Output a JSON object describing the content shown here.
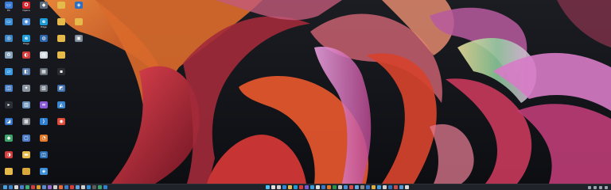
{
  "colors": {
    "background": "#0f1115",
    "taskbar": "#1f2228",
    "accent_orange": "#e0642a",
    "accent_red": "#c02a36",
    "accent_pink": "#e77bd8",
    "accent_yellow": "#e8d36a"
  },
  "desktop": {
    "icons": [
      {
        "label": "PC",
        "icon": "pc-icon",
        "color": "#3a7bd5",
        "glyph": "▭"
      },
      {
        "label": "Opera",
        "icon": "opera-icon",
        "color": "#d8262e",
        "glyph": "O"
      },
      {
        "label": "",
        "icon": "app-icon",
        "color": "#5e6b7a",
        "glyph": "◆"
      },
      {
        "label": "",
        "icon": "folder-icon",
        "color": "#e6b94b",
        "glyph": ""
      },
      {
        "label": "",
        "icon": "app-icon",
        "color": "#2f6fbf",
        "glyph": "◈"
      },
      {
        "label": "",
        "icon": "monitor-icon",
        "color": "#3a8fd6",
        "glyph": "▭"
      },
      {
        "label": "",
        "icon": "app-icon",
        "color": "#4b8bd1",
        "glyph": "◉"
      },
      {
        "label": "Edge",
        "icon": "edge-icon",
        "color": "#1f9bd8",
        "glyph": "e"
      },
      {
        "label": "",
        "icon": "folder-icon",
        "color": "#e6b94b",
        "glyph": ""
      },
      {
        "label": "",
        "icon": "folder-icon",
        "color": "#e6b94b",
        "glyph": ""
      },
      {
        "label": "",
        "icon": "network-icon",
        "color": "#3d86c6",
        "glyph": "◎"
      },
      {
        "label": "Edge",
        "icon": "edge-icon",
        "color": "#1f9bd8",
        "glyph": "e"
      },
      {
        "label": "",
        "icon": "app-icon",
        "color": "#2d64a8",
        "glyph": "◍"
      },
      {
        "label": "",
        "icon": "folder-icon",
        "color": "#e6b94b",
        "glyph": ""
      },
      {
        "label": "",
        "icon": "app-icon",
        "color": "#7f8b99",
        "glyph": "▣"
      },
      {
        "label": "",
        "icon": "recycle-bin-icon",
        "color": "#8aa4bd",
        "glyph": "♻"
      },
      {
        "label": "",
        "icon": "app-icon",
        "color": "#d43a3a",
        "glyph": "◐"
      },
      {
        "label": "",
        "icon": "app-icon",
        "color": "#cfd6de",
        "glyph": "▤"
      },
      {
        "label": "",
        "icon": "folder-icon",
        "color": "#e6b94b",
        "glyph": ""
      },
      {
        "label": "",
        "icon": "empty",
        "color": "transparent",
        "glyph": ""
      },
      {
        "label": "",
        "icon": "chat-icon",
        "color": "#3d9ae0",
        "glyph": "▱"
      },
      {
        "label": "",
        "icon": "app-icon",
        "color": "#5277a6",
        "glyph": "◧"
      },
      {
        "label": "",
        "icon": "app-icon",
        "color": "#666e78",
        "glyph": "▦"
      },
      {
        "label": "",
        "icon": "app-icon",
        "color": "#2a2d33",
        "glyph": "▪"
      },
      {
        "label": "",
        "icon": "empty",
        "color": "transparent",
        "glyph": ""
      },
      {
        "label": "",
        "icon": "app-icon",
        "color": "#4a7fc4",
        "glyph": "◫"
      },
      {
        "label": "",
        "icon": "settings-icon",
        "color": "#8b949e",
        "glyph": "✦"
      },
      {
        "label": "",
        "icon": "app-icon",
        "color": "#6d7580",
        "glyph": "▧"
      },
      {
        "label": "",
        "icon": "app-icon",
        "color": "#3f6ea8",
        "glyph": "◩"
      },
      {
        "label": "",
        "icon": "empty",
        "color": "transparent",
        "glyph": ""
      },
      {
        "label": "",
        "icon": "terminal-icon",
        "color": "#2b2f36",
        "glyph": "▸"
      },
      {
        "label": "",
        "icon": "app-icon",
        "color": "#6a8fb8",
        "glyph": "▥"
      },
      {
        "label": "",
        "icon": "visual-studio-icon",
        "color": "#8a5bd6",
        "glyph": "∞"
      },
      {
        "label": "",
        "icon": "app-icon",
        "color": "#3a86d0",
        "glyph": "◭"
      },
      {
        "label": "",
        "icon": "empty",
        "color": "transparent",
        "glyph": ""
      },
      {
        "label": "",
        "icon": "app-icon",
        "color": "#3376c9",
        "glyph": "◪"
      },
      {
        "label": "",
        "icon": "app-icon",
        "color": "#7a818a",
        "glyph": "▩"
      },
      {
        "label": "",
        "icon": "vscode-icon",
        "color": "#2f80d1",
        "glyph": "⟩"
      },
      {
        "label": "",
        "icon": "chrome-icon",
        "color": "#dd4b39",
        "glyph": "◉"
      },
      {
        "label": "",
        "icon": "empty",
        "color": "transparent",
        "glyph": ""
      },
      {
        "label": "",
        "icon": "app-icon",
        "color": "#3fa36b",
        "glyph": "◆"
      },
      {
        "label": "",
        "icon": "app-icon",
        "color": "#4d7cc2",
        "glyph": "▢"
      },
      {
        "label": "",
        "icon": "app-icon",
        "color": "#e07a2a",
        "glyph": "◔"
      },
      {
        "label": "",
        "icon": "empty",
        "color": "transparent",
        "glyph": ""
      },
      {
        "label": "",
        "icon": "empty",
        "color": "transparent",
        "glyph": ""
      },
      {
        "label": "",
        "icon": "app-icon",
        "color": "#d23c3c",
        "glyph": "◑"
      },
      {
        "label": "",
        "icon": "app-icon",
        "color": "#e6b94b",
        "glyph": "▬"
      },
      {
        "label": "",
        "icon": "app-icon",
        "color": "#2c6fb5",
        "glyph": "◫"
      },
      {
        "label": "",
        "icon": "empty",
        "color": "transparent",
        "glyph": ""
      },
      {
        "label": "",
        "icon": "empty",
        "color": "transparent",
        "glyph": ""
      },
      {
        "label": "",
        "icon": "folder-icon",
        "color": "#e6b94b",
        "glyph": ""
      },
      {
        "label": "",
        "icon": "folder-icon",
        "color": "#d9a83a",
        "glyph": ""
      },
      {
        "label": "",
        "icon": "app-icon",
        "color": "#3c8fd8",
        "glyph": "◈"
      },
      {
        "label": "",
        "icon": "empty",
        "color": "transparent",
        "glyph": ""
      },
      {
        "label": "",
        "icon": "empty",
        "color": "transparent",
        "glyph": ""
      }
    ]
  },
  "taskbar": {
    "left": [
      {
        "icon": "widgets-icon",
        "color": "#4aa3df"
      },
      {
        "icon": "app-icon",
        "color": "#3b82c8"
      },
      {
        "icon": "app-icon",
        "color": "#d9d9d9"
      },
      {
        "icon": "app-icon",
        "color": "#4c7ecf"
      },
      {
        "icon": "app-icon",
        "color": "#3bb07a"
      },
      {
        "icon": "app-icon",
        "color": "#d04040"
      },
      {
        "icon": "app-icon",
        "color": "#e0a030"
      },
      {
        "icon": "app-icon",
        "color": "#5a8fd6"
      },
      {
        "icon": "app-icon",
        "color": "#9a6bd1"
      },
      {
        "icon": "app-icon",
        "color": "#cccccc"
      },
      {
        "icon": "app-icon",
        "color": "#e86a3a"
      },
      {
        "icon": "app-icon",
        "color": "#3e7cc4"
      },
      {
        "icon": "app-icon",
        "color": "#d93d3d"
      },
      {
        "icon": "app-icon",
        "color": "#62a0e0"
      },
      {
        "icon": "app-icon",
        "color": "#cfcfcf"
      },
      {
        "icon": "app-icon",
        "color": "#2f8fd8"
      },
      {
        "icon": "app-icon",
        "color": "#5d5d5d"
      },
      {
        "icon": "app-icon",
        "color": "#38a169"
      },
      {
        "icon": "app-icon",
        "color": "#3182ce"
      }
    ],
    "center": [
      {
        "icon": "start-icon",
        "color": "#4cc2ff"
      },
      {
        "icon": "search-icon",
        "color": "#e0e0e0"
      },
      {
        "icon": "task-view-icon",
        "color": "#d0d0d0"
      },
      {
        "icon": "app-icon",
        "color": "#2e8bd8"
      },
      {
        "icon": "app-icon",
        "color": "#e6b94b"
      },
      {
        "icon": "app-icon",
        "color": "#1f9bd8"
      },
      {
        "icon": "app-icon",
        "color": "#d83b3b"
      },
      {
        "icon": "app-icon",
        "color": "#7d5bd0"
      },
      {
        "icon": "app-icon",
        "color": "#3aa0e0"
      },
      {
        "icon": "app-icon",
        "color": "#dddddd"
      },
      {
        "icon": "app-icon",
        "color": "#3c7cc7"
      },
      {
        "icon": "app-icon",
        "color": "#e07a2a"
      },
      {
        "icon": "app-icon",
        "color": "#2b9348"
      },
      {
        "icon": "app-icon",
        "color": "#c0c0c0"
      },
      {
        "icon": "app-icon",
        "color": "#4a90d9"
      },
      {
        "icon": "app-icon",
        "color": "#d94d4d"
      },
      {
        "icon": "app-icon",
        "color": "#6aa9e8"
      },
      {
        "icon": "app-icon",
        "color": "#8c8c8c"
      },
      {
        "icon": "app-icon",
        "color": "#3478c6"
      },
      {
        "icon": "app-icon",
        "color": "#e0b040"
      },
      {
        "icon": "app-icon",
        "color": "#46a0da"
      },
      {
        "icon": "app-icon",
        "color": "#d0d0d0"
      },
      {
        "icon": "app-icon",
        "color": "#2f6fb5"
      },
      {
        "icon": "app-icon",
        "color": "#c84d4d"
      },
      {
        "icon": "app-icon",
        "color": "#5b9bd5"
      },
      {
        "icon": "app-icon",
        "color": "#d8d8d8"
      }
    ]
  }
}
